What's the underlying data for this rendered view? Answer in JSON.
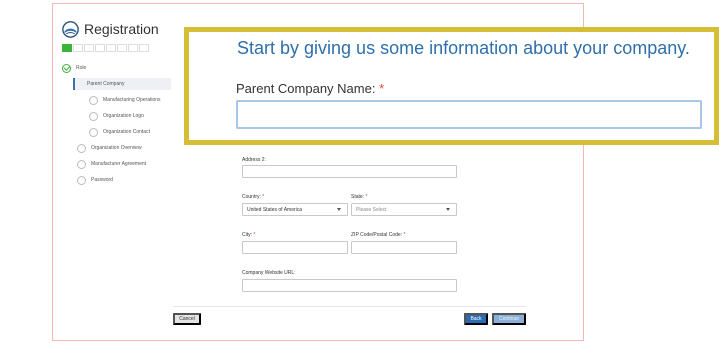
{
  "header": {
    "title": "Registration"
  },
  "progress": {
    "total": 8,
    "completed": 1
  },
  "steps": [
    {
      "label": "Role",
      "status": "done"
    },
    {
      "label": "Parent Company",
      "status": "active"
    },
    {
      "label": "Manufacturing Operations",
      "status": "pending"
    },
    {
      "label": "Organization Logo",
      "status": "pending"
    },
    {
      "label": "Organization Contact",
      "status": "pending"
    },
    {
      "label": "Organization Overview",
      "status": "pending"
    },
    {
      "label": "Manufacturer Agreement",
      "status": "pending"
    },
    {
      "label": "Password",
      "status": "pending"
    }
  ],
  "form": {
    "address2_label": "Address 2:",
    "country_label": "Country:",
    "country_value": "United States of America",
    "state_label": "State:",
    "state_placeholder": "Please Select",
    "city_label": "City:",
    "zip_label": "ZIP Code/Postal Code:",
    "website_label": "Company Website URL:",
    "required_mark": "*"
  },
  "buttons": {
    "cancel": "Cancel",
    "back": "Back",
    "continue": "Continue"
  },
  "callout": {
    "heading": "Start by giving us some information about your company.",
    "label": "Parent Company Name:",
    "required_mark": "*",
    "input_value": ""
  },
  "colors": {
    "accent": "#2b6cb0",
    "success": "#3bb33b",
    "callout_border": "#d6bd36",
    "required": "#e0463a"
  }
}
